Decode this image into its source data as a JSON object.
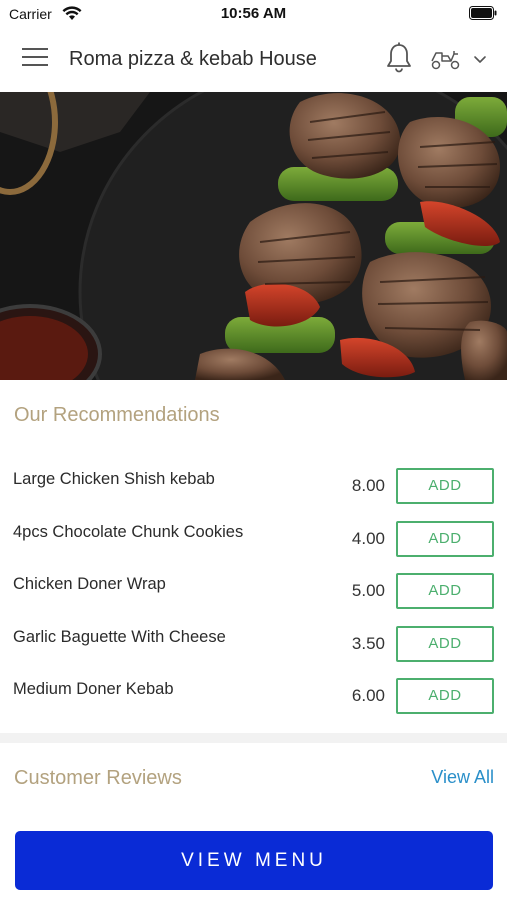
{
  "status_bar": {
    "carrier": "Carrier",
    "time": "10:56 AM"
  },
  "nav": {
    "title": "Roma pizza & kebab House",
    "icons": [
      "menu-icon",
      "bell-icon",
      "delivery-scooter-icon",
      "chevron-down-icon"
    ]
  },
  "hero": {
    "icon": "kebab-skewers-photo"
  },
  "recommendations": {
    "title": "Our Recommendations",
    "add_label": "ADD",
    "items": [
      {
        "name": "Large Chicken Shish kebab",
        "price": "8.00"
      },
      {
        "name": "4pcs Chocolate Chunk Cookies",
        "price": "4.00"
      },
      {
        "name": "Chicken Doner Wrap",
        "price": "5.00"
      },
      {
        "name": "Garlic Baguette With Cheese",
        "price": "3.50"
      },
      {
        "name": "Medium Doner Kebab",
        "price": "6.00"
      }
    ]
  },
  "reviews": {
    "title": "Customer Reviews",
    "view_all": "View All"
  },
  "cta": {
    "view_menu": "VIEW MENU"
  },
  "colors": {
    "accent_gold": "#b3a27f",
    "add_green": "#4caf6e",
    "link_blue": "#2a8fc9",
    "cta_blue": "#0a2bd6"
  }
}
